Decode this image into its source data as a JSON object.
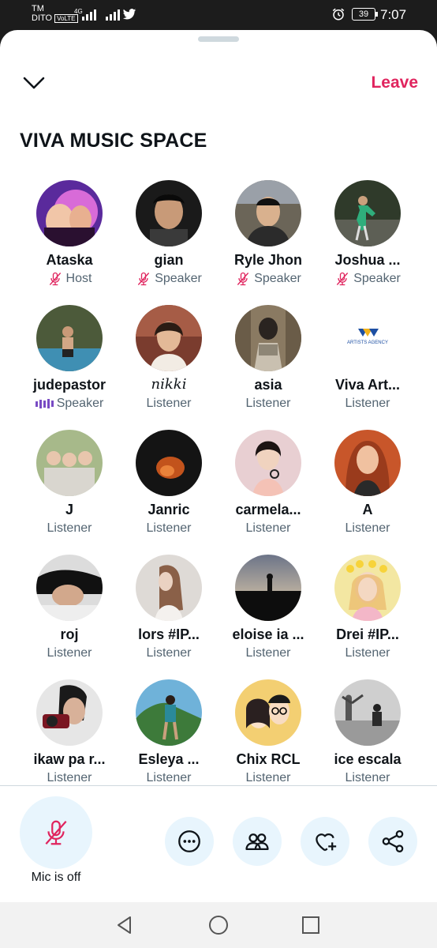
{
  "status_bar": {
    "carrier_top": "TM",
    "carrier": "DITO",
    "volte": "VoLTE",
    "network": "4G",
    "battery": "39",
    "time": "7:07"
  },
  "space": {
    "title": "VIVA MUSIC SPACE",
    "leave_label": "Leave",
    "participants": [
      {
        "name": "Ataska",
        "role": "Host",
        "indicator": "mic-off"
      },
      {
        "name": "gian",
        "role": "Speaker",
        "indicator": "mic-off"
      },
      {
        "name": "Ryle Jhon",
        "role": "Speaker",
        "indicator": "mic-off"
      },
      {
        "name": "Joshua ...",
        "role": "Speaker",
        "indicator": "mic-off"
      },
      {
        "name": "judepastor",
        "role": "Speaker",
        "indicator": "speaking"
      },
      {
        "name": "nikki",
        "role": "Listener",
        "indicator": "none"
      },
      {
        "name": "asia",
        "role": "Listener",
        "indicator": "none"
      },
      {
        "name": "Viva Art...",
        "role": "Listener",
        "indicator": "none",
        "avatar_logo": "ARTISTS AGENCY"
      },
      {
        "name": "J",
        "role": "Listener",
        "indicator": "none"
      },
      {
        "name": "Janric",
        "role": "Listener",
        "indicator": "none"
      },
      {
        "name": "carmela...",
        "role": "Listener",
        "indicator": "none"
      },
      {
        "name": "A",
        "role": "Listener",
        "indicator": "none"
      },
      {
        "name": "roj",
        "role": "Listener",
        "indicator": "none"
      },
      {
        "name": "lors #IP...",
        "role": "Listener",
        "indicator": "none"
      },
      {
        "name": "eloise ia ...",
        "role": "Listener",
        "indicator": "none"
      },
      {
        "name": "Drei #IP...",
        "role": "Listener",
        "indicator": "none"
      },
      {
        "name": "ikaw pa r...",
        "role": "Listener",
        "indicator": "none"
      },
      {
        "name": "Esleya ...",
        "role": "Listener",
        "indicator": "none"
      },
      {
        "name": "Chix RCL",
        "role": "Listener",
        "indicator": "none"
      },
      {
        "name": "ice escala",
        "role": "Listener",
        "indicator": "none"
      }
    ]
  },
  "controls": {
    "mic_label": "Mic is off",
    "actions": [
      "more-icon",
      "people-icon",
      "heart-plus-icon",
      "share-icon"
    ]
  },
  "colors": {
    "accent": "#e0245e",
    "twitter_blue": "#1d9bf0",
    "speaking": "#794bc4",
    "muted_text": "#536471"
  }
}
